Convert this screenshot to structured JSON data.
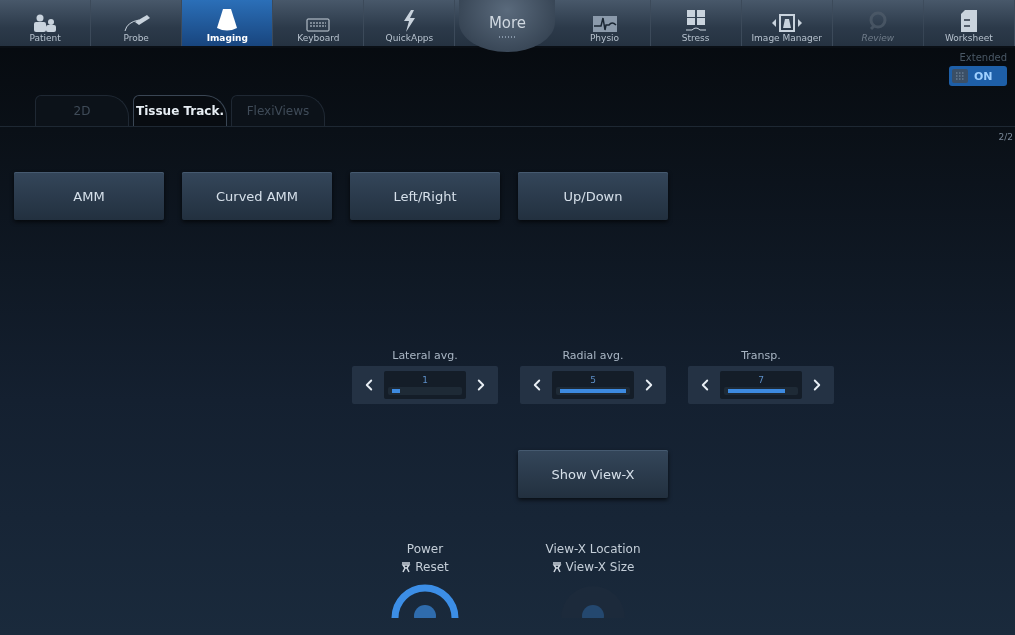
{
  "top_nav": [
    {
      "label": "Patient",
      "selected": false,
      "disabled": false,
      "kind": "tab"
    },
    {
      "label": "Probe",
      "selected": false,
      "disabled": false,
      "kind": "tab"
    },
    {
      "label": "Imaging",
      "selected": true,
      "disabled": false,
      "kind": "tab"
    },
    {
      "label": "Keyboard",
      "selected": false,
      "disabled": false,
      "kind": "tab"
    },
    {
      "label": "QuickApps",
      "selected": false,
      "disabled": false,
      "kind": "tab"
    },
    {
      "label": "More",
      "kind": "more"
    },
    {
      "label": "Physio",
      "selected": false,
      "disabled": false,
      "kind": "tab"
    },
    {
      "label": "Stress",
      "selected": false,
      "disabled": false,
      "kind": "tab"
    },
    {
      "label": "Image Manager",
      "selected": false,
      "disabled": false,
      "kind": "tab"
    },
    {
      "label": "Review",
      "selected": false,
      "disabled": true,
      "kind": "tab"
    },
    {
      "label": "Worksheet",
      "selected": false,
      "disabled": false,
      "kind": "tab"
    }
  ],
  "tabs": [
    {
      "label": "2D",
      "selected": false
    },
    {
      "label": "Tissue Track.",
      "selected": true
    },
    {
      "label": "FlexiViews",
      "selected": false
    }
  ],
  "extended": {
    "label": "Extended",
    "toggle": "ON",
    "on": true
  },
  "page_indicator": "2/2",
  "buttons": [
    "AMM",
    "Curved AMM",
    "Left/Right",
    "Up/Down"
  ],
  "sliders": [
    {
      "label": "Lateral avg.",
      "value": "1",
      "level": 0.12
    },
    {
      "label": "Radial avg.",
      "value": "5",
      "level": 1.0
    },
    {
      "label": "Transp.",
      "value": "7",
      "level": 0.87
    }
  ],
  "show_view_button": "Show View-X",
  "knobs": [
    {
      "label": "Power",
      "sub_label": "Reset",
      "active": true
    },
    {
      "label": "View-X Location",
      "sub_label": "View-X Size",
      "active": false
    }
  ]
}
